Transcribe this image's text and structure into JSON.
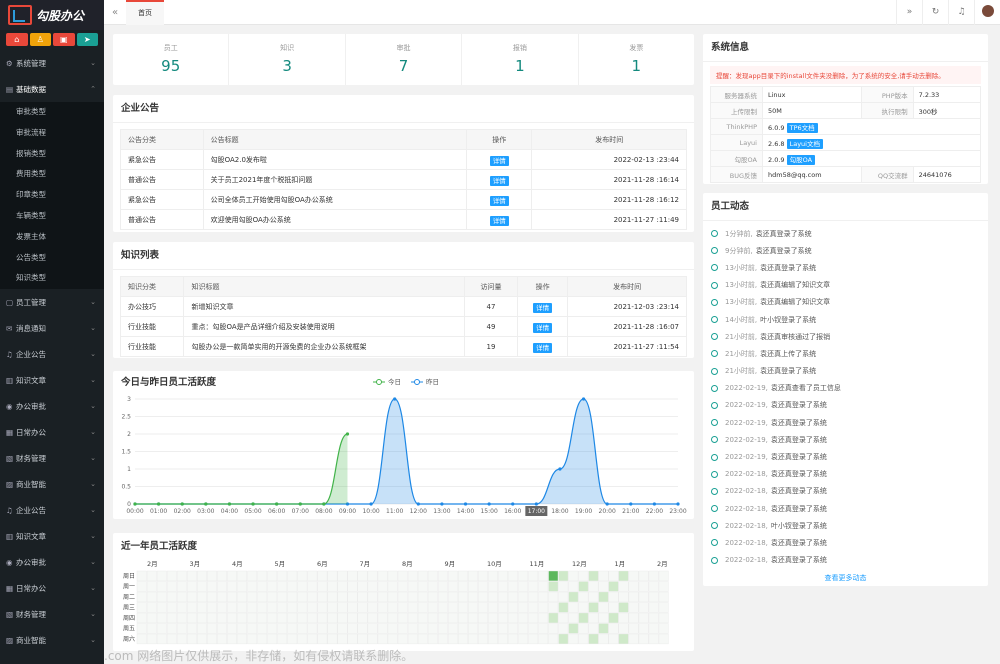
{
  "app": {
    "name": "勾股办公",
    "logo_mark": "OA"
  },
  "sidebar": {
    "quick": [
      {
        "icon": "home-icon",
        "glyph": "⌂",
        "color": "#e8483a"
      },
      {
        "icon": "user-icon",
        "glyph": "♙",
        "color": "#f0a30a"
      },
      {
        "icon": "lock-icon",
        "glyph": "▣",
        "color": "#e8483a"
      },
      {
        "icon": "send-icon",
        "glyph": "➤",
        "color": "#1aa094"
      }
    ],
    "menu_top": [
      {
        "label": "系统管理",
        "icon": "gear-icon",
        "glyph": "⚙"
      },
      {
        "label": "基础数据",
        "icon": "database-icon",
        "glyph": "▤"
      }
    ],
    "sub": [
      "审批类型",
      "审批流程",
      "报销类型",
      "费用类型",
      "印章类型",
      "车辆类型",
      "发票主体",
      "公告类型",
      "知识类型"
    ],
    "menu_bottom": [
      {
        "label": "员工管理",
        "icon": "staff-icon",
        "glyph": "▢"
      },
      {
        "label": "消息通知",
        "icon": "message-icon",
        "glyph": "✉"
      },
      {
        "label": "企业公告",
        "icon": "bell-icon",
        "glyph": "♫"
      },
      {
        "label": "知识文章",
        "icon": "article-icon",
        "glyph": "▥"
      },
      {
        "label": "办公审批",
        "icon": "approve-icon",
        "glyph": "◉"
      },
      {
        "label": "日常办公",
        "icon": "calendar-icon",
        "glyph": "▦"
      },
      {
        "label": "财务管理",
        "icon": "finance-icon",
        "glyph": "▧"
      },
      {
        "label": "商业智能",
        "icon": "bi-icon",
        "glyph": "▨"
      },
      {
        "label": "企业公告",
        "icon": "bell-icon",
        "glyph": "♫"
      },
      {
        "label": "知识文章",
        "icon": "article-icon",
        "glyph": "▥"
      },
      {
        "label": "办公审批",
        "icon": "approve-icon",
        "glyph": "◉"
      },
      {
        "label": "日常办公",
        "icon": "calendar-icon",
        "glyph": "▦"
      },
      {
        "label": "财务管理",
        "icon": "finance-icon",
        "glyph": "▧"
      },
      {
        "label": "商业智能",
        "icon": "bi-icon",
        "glyph": "▨"
      }
    ]
  },
  "header": {
    "tab": "首页"
  },
  "stats": [
    {
      "label": "员工",
      "value": "95"
    },
    {
      "label": "知识",
      "value": "3"
    },
    {
      "label": "审批",
      "value": "7"
    },
    {
      "label": "报销",
      "value": "1"
    },
    {
      "label": "发票",
      "value": "1"
    }
  ],
  "notice": {
    "title": "企业公告",
    "cols": [
      "公告分类",
      "公告标题",
      "操作",
      "发布时间"
    ],
    "detail": "详情",
    "rows": [
      [
        "紧急公告",
        "勾股OA2.0发布啦",
        "2022-02-13 :23:44"
      ],
      [
        "普通公告",
        "关于员工2021年度个税抵扣问题",
        "2021-11-28 :16:14"
      ],
      [
        "紧急公告",
        "公司全体员工开始使用勾股OA办公系统",
        "2021-11-28 :16:12"
      ],
      [
        "普通公告",
        "欢迎使用勾股OA办公系统",
        "2021-11-27 :11:49"
      ]
    ]
  },
  "knowledge": {
    "title": "知识列表",
    "cols": [
      "知识分类",
      "知识标题",
      "访问量",
      "操作",
      "发布时间"
    ],
    "rows": [
      [
        "办公技巧",
        "新增知识文章",
        "47",
        "2021-12-03 :23:14"
      ],
      [
        "行业技能",
        "重点：勾股OA是产品详细介绍及安装使用说明",
        "49",
        "2021-11-28 :16:07"
      ],
      [
        "行业技能",
        "勾股办公是一款简单实用的开源免费的企业办公系统框架",
        "19",
        "2021-11-27 :11:54"
      ]
    ]
  },
  "sysinfo": {
    "title": "系统信息",
    "warn": "提醒：发现app目录下的install文件夹没删除，为了系统的安全,请手动去删除。",
    "rows": [
      [
        "服务器系统",
        "Linux",
        "PHP版本",
        "7.2.33"
      ],
      [
        "上传限制",
        "50M",
        "执行限制",
        "300秒"
      ]
    ],
    "ver": [
      [
        "ThinkPHP",
        "6.0.9",
        "TP6文档"
      ],
      [
        "Layui",
        "2.6.8",
        "Layui文档"
      ],
      [
        "勾股OA",
        "2.0.9",
        "勾股OA"
      ]
    ],
    "bug_k": "BUG反馈",
    "bug_v": "hdm58@qq.com",
    "qq_k": "QQ交流群",
    "qq_v": "24641076"
  },
  "activity": {
    "title": "员工动态",
    "more": "查看更多动态",
    "items": [
      [
        "1分钟前,",
        "袁还真登录了系统"
      ],
      [
        "9分钟前,",
        "袁还真登录了系统"
      ],
      [
        "13小时前,",
        "袁还真登录了系统"
      ],
      [
        "13小时前,",
        "袁还真编辑了知识文章"
      ],
      [
        "13小时前,",
        "袁还真编辑了知识文章"
      ],
      [
        "14小时前,",
        "叶小钗登录了系统"
      ],
      [
        "21小时前,",
        "袁还真审核通过了报销"
      ],
      [
        "21小时前,",
        "袁还真上传了系统"
      ],
      [
        "21小时前,",
        "袁还真登录了系统"
      ],
      [
        "2022-02-19,",
        "袁还真查看了员工信息"
      ],
      [
        "2022-02-19,",
        "袁还真登录了系统"
      ],
      [
        "2022-02-19,",
        "袁还真登录了系统"
      ],
      [
        "2022-02-19,",
        "袁还真登录了系统"
      ],
      [
        "2022-02-19,",
        "袁还真登录了系统"
      ],
      [
        "2022-02-18,",
        "袁还真登录了系统"
      ],
      [
        "2022-02-18,",
        "袁还真登录了系统"
      ],
      [
        "2022-02-18,",
        "袁还真登录了系统"
      ],
      [
        "2022-02-18,",
        "叶小钗登录了系统"
      ],
      [
        "2022-02-18,",
        "袁还真登录了系统"
      ],
      [
        "2022-02-18,",
        "袁还真登录了系统"
      ]
    ]
  },
  "chart_data": [
    {
      "type": "area",
      "title": "今日与昨日员工活跃度",
      "legend": [
        "今日",
        "昨日"
      ],
      "x": [
        "00:00",
        "01:00",
        "02:00",
        "03:00",
        "04:00",
        "05:00",
        "06:00",
        "07:00",
        "08:00",
        "09:00",
        "10:00",
        "11:00",
        "12:00",
        "13:00",
        "14:00",
        "15:00",
        "16:00",
        "17:00",
        "18:00",
        "19:00",
        "20:00",
        "21:00",
        "22:00",
        "23:00"
      ],
      "ylim": [
        0,
        3
      ],
      "yticks": [
        "0",
        "0.5",
        "1",
        "1.5",
        "2",
        "2.5",
        "3"
      ],
      "series": [
        {
          "name": "今日",
          "color": "#41b349",
          "values": [
            0,
            0,
            0,
            0,
            0,
            0,
            0,
            0,
            0,
            2
          ]
        },
        {
          "name": "昨日",
          "color": "#1e88e5",
          "values": [
            0,
            0,
            0,
            0,
            0,
            0,
            0,
            0,
            0,
            0,
            0,
            3,
            0,
            0,
            0,
            0,
            0,
            0,
            1,
            3,
            0,
            0,
            0,
            0
          ]
        }
      ],
      "highlight_x": "17:00"
    },
    {
      "type": "heatmap",
      "title": "近一年员工活跃度",
      "months": [
        "2月",
        "3月",
        "4月",
        "5月",
        "6月",
        "7月",
        "8月",
        "9月",
        "10月",
        "11月",
        "12月",
        "1月",
        "2月"
      ],
      "weekdays": [
        "周日",
        "周一",
        "周二",
        "周三",
        "周四",
        "周五",
        "周六"
      ]
    }
  ],
  "watermark": ".com 网络图片仅供展示，非存储，如有侵权请联系删除。"
}
